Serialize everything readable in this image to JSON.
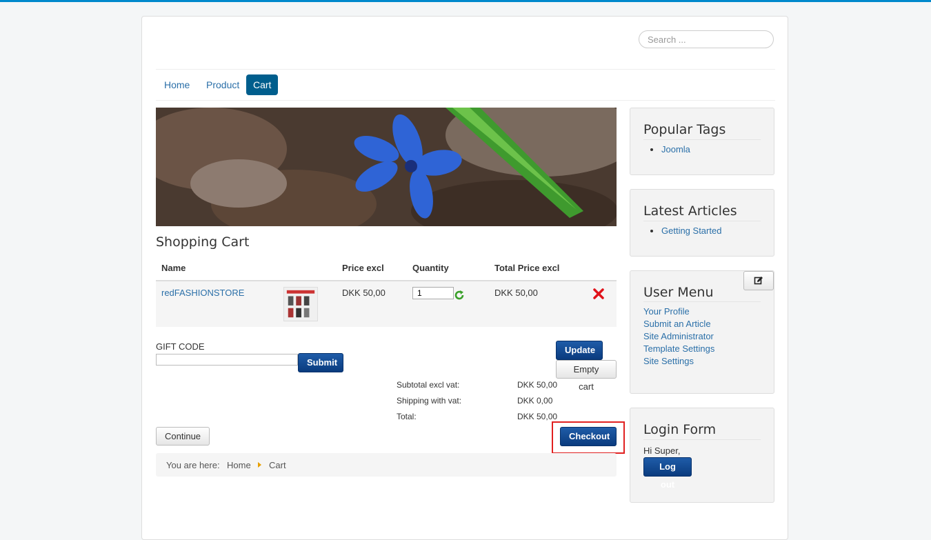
{
  "search": {
    "placeholder": "Search ..."
  },
  "nav": {
    "items": [
      "Home",
      "Product",
      "Cart"
    ],
    "active": "Cart"
  },
  "page": {
    "title": "Shopping Cart"
  },
  "cart": {
    "columns": [
      "Name",
      "Price excl",
      "Quantity",
      "Total Price excl"
    ],
    "items": [
      {
        "name": "redFASHIONSTORE",
        "price": "DKK 50,00",
        "quantity": "1",
        "total": "DKK 50,00"
      }
    ],
    "gift_code_label": "GIFT CODE",
    "submit_label": "Submit",
    "update_label": "Update",
    "empty_cart_label": "Empty cart",
    "totals": [
      {
        "label": "Subtotal excl vat:",
        "value": "DKK 50,00"
      },
      {
        "label": "Shipping with vat:",
        "value": "DKK 0,00"
      },
      {
        "label": "Total:",
        "value": "DKK 50,00"
      }
    ],
    "continue_label": "Continue",
    "checkout_label": "Checkout"
  },
  "breadcrumb": {
    "prefix": "You are here:",
    "items": [
      "Home",
      "Cart"
    ]
  },
  "sidebar": {
    "popular_tags": {
      "title": "Popular Tags",
      "items": [
        "Joomla"
      ]
    },
    "latest_articles": {
      "title": "Latest Articles",
      "items": [
        "Getting Started"
      ]
    },
    "user_menu": {
      "title": "User Menu",
      "items": [
        "Your Profile",
        "Submit an Article",
        "Site Administrator",
        "Template Settings",
        "Site Settings"
      ]
    },
    "login_form": {
      "title": "Login Form",
      "greeting": "Hi Super,",
      "logout_label": "Log out"
    }
  },
  "colors": {
    "accent": "#005e8d",
    "link": "#2a6fa8",
    "highlight": "#e02020",
    "top_bar": "#0088cc"
  }
}
